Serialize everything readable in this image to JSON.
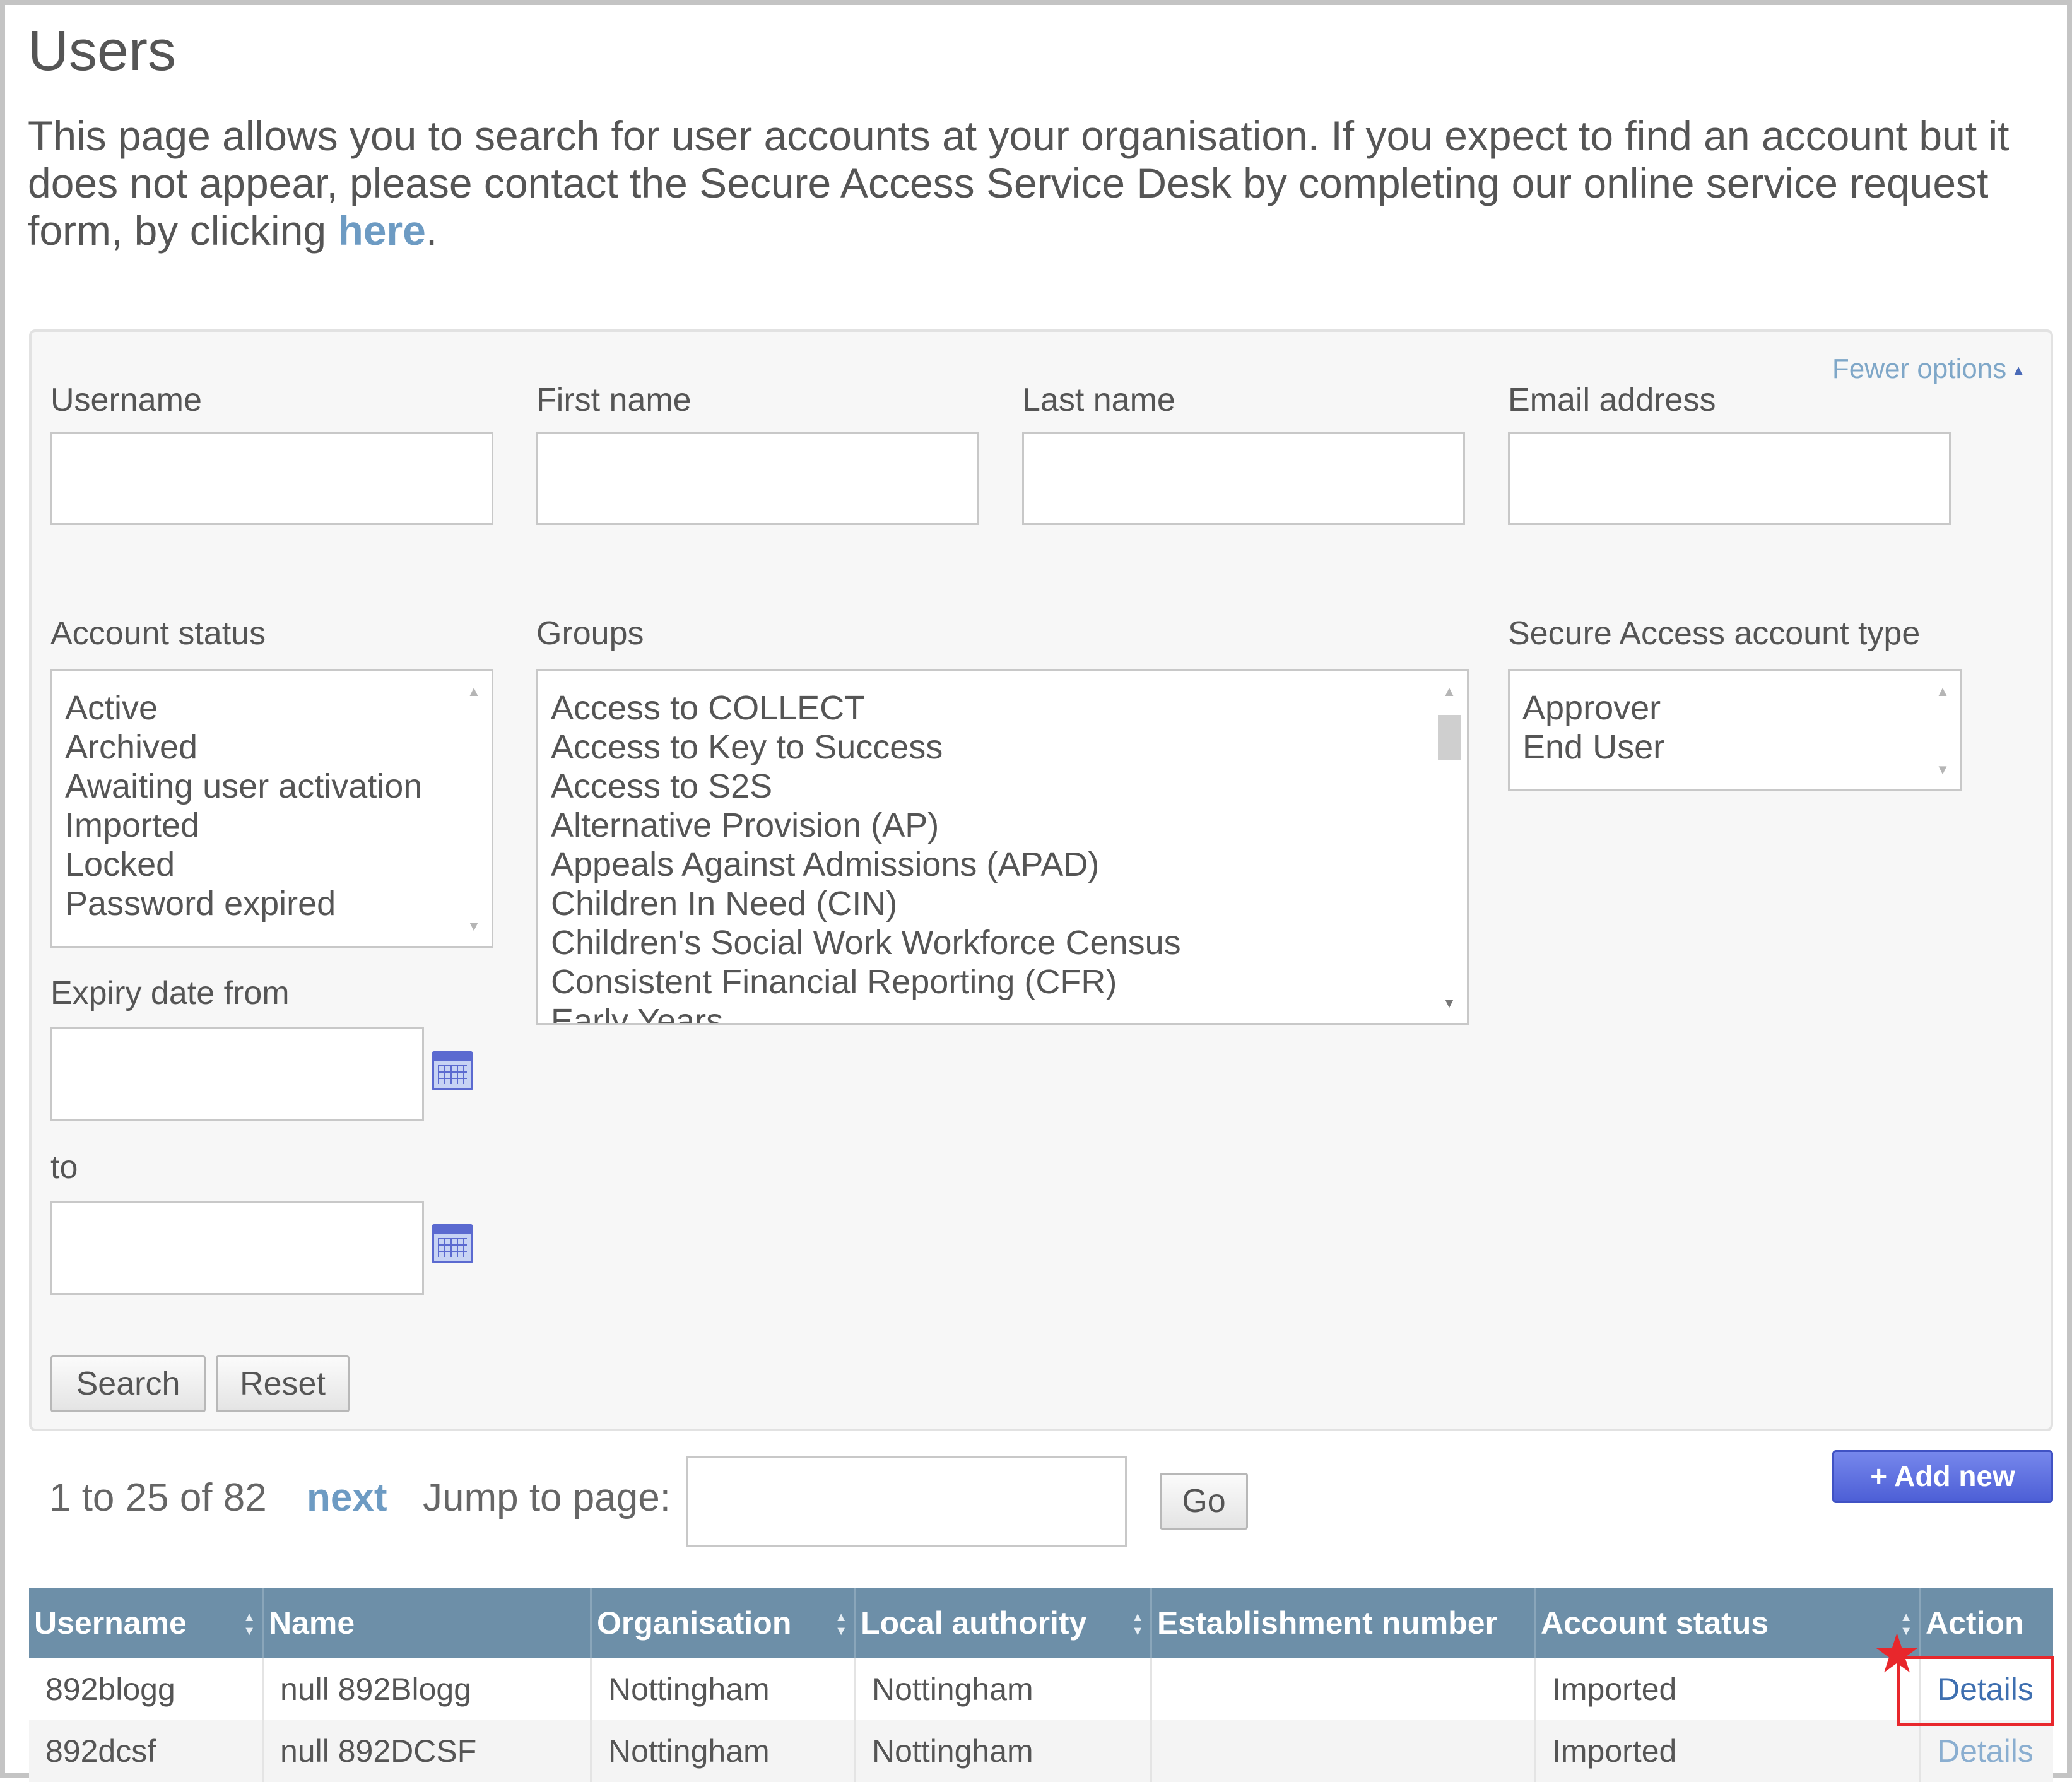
{
  "page": {
    "title": "Users",
    "intro_text": "This page allows you to search for user accounts at your organisation. If you expect to find an account but it does not appear, please contact the Secure Access Service Desk by completing our online service request form, by clicking ",
    "intro_link": "here",
    "intro_end": "."
  },
  "search": {
    "toggle_label": "Fewer options",
    "fields": {
      "username_label": "Username",
      "first_name_label": "First name",
      "last_name_label": "Last name",
      "email_label": "Email address",
      "username_value": "",
      "first_name_value": "",
      "last_name_value": "",
      "email_value": ""
    },
    "account_status": {
      "label": "Account status",
      "options": [
        "Active",
        "Archived",
        "Awaiting user activation",
        "Imported",
        "Locked",
        "Password expired"
      ]
    },
    "groups": {
      "label": "Groups",
      "options": [
        "Access to COLLECT",
        "Access to Key to Success",
        "Access to S2S",
        "Alternative Provision (AP)",
        "Appeals Against Admissions (APAD)",
        "Children In Need (CIN)",
        "Children's Social Work Workforce Census",
        "Consistent Financial Reporting (CFR)",
        "Early Years"
      ]
    },
    "account_type": {
      "label": "Secure Access account type",
      "options": [
        "Approver",
        "End User"
      ]
    },
    "expiry": {
      "from_label": "Expiry date from",
      "to_label": "to",
      "from_value": "",
      "to_value": ""
    },
    "search_button": "Search",
    "reset_button": "Reset"
  },
  "pagination": {
    "range_text": "1 to 25 of 82",
    "next_label": "next",
    "jump_label": "Jump to page:",
    "jump_value": "",
    "go_button": "Go"
  },
  "add_new_button": "+ Add new",
  "table": {
    "columns": [
      "Username",
      "Name",
      "Organisation",
      "Local authority",
      "Establishment number",
      "Account status",
      "Action"
    ],
    "rows": [
      [
        "892blogg",
        "null 892Blogg",
        "Nottingham",
        "Nottingham",
        "",
        "Imported",
        "Details"
      ],
      [
        "892dcsf",
        "null 892DCSF",
        "Nottingham",
        "Nottingham",
        "",
        "Imported",
        "Details"
      ]
    ]
  },
  "colors": {
    "link": "#6d9bc3",
    "table_header": "#6d8fa8",
    "add_button": "#5b6ad0",
    "highlight": "#e8272c"
  }
}
